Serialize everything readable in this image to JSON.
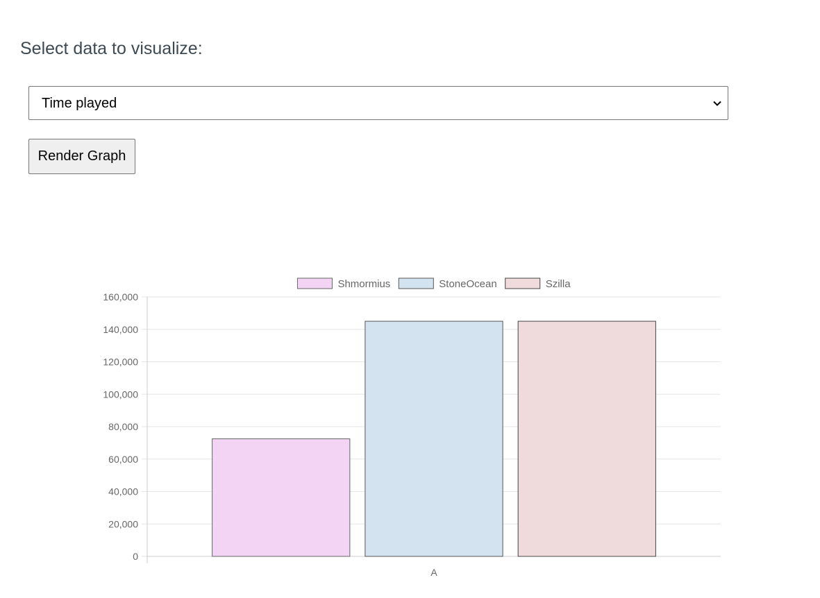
{
  "controls": {
    "prompt_label": "Select data to visualize:",
    "select_value": "Time played",
    "render_button_label": "Render Graph"
  },
  "chart_data": {
    "type": "bar",
    "categories": [
      "A"
    ],
    "series": [
      {
        "name": "Shmormius",
        "values": [
          72500
        ],
        "fill": "#f3d4f5",
        "stroke": "#666666"
      },
      {
        "name": "StoneOcean",
        "values": [
          145000
        ],
        "fill": "#d4e3f0",
        "stroke": "#555555"
      },
      {
        "name": "Szilla",
        "values": [
          145000
        ],
        "fill": "#f0dbdc",
        "stroke": "#444444"
      }
    ],
    "ylim": [
      0,
      160000
    ],
    "yticks": [
      0,
      20000,
      40000,
      60000,
      80000,
      100000,
      120000,
      140000,
      160000
    ],
    "ytick_labels": [
      "0",
      "20,000",
      "40,000",
      "60,000",
      "80,000",
      "100,000",
      "120,000",
      "140,000",
      "160,000"
    ],
    "grid": true,
    "legend": "top-center",
    "colors": {
      "grid": "#e6e6e6",
      "axis": "#cccccc",
      "tick_text": "#666666"
    }
  }
}
